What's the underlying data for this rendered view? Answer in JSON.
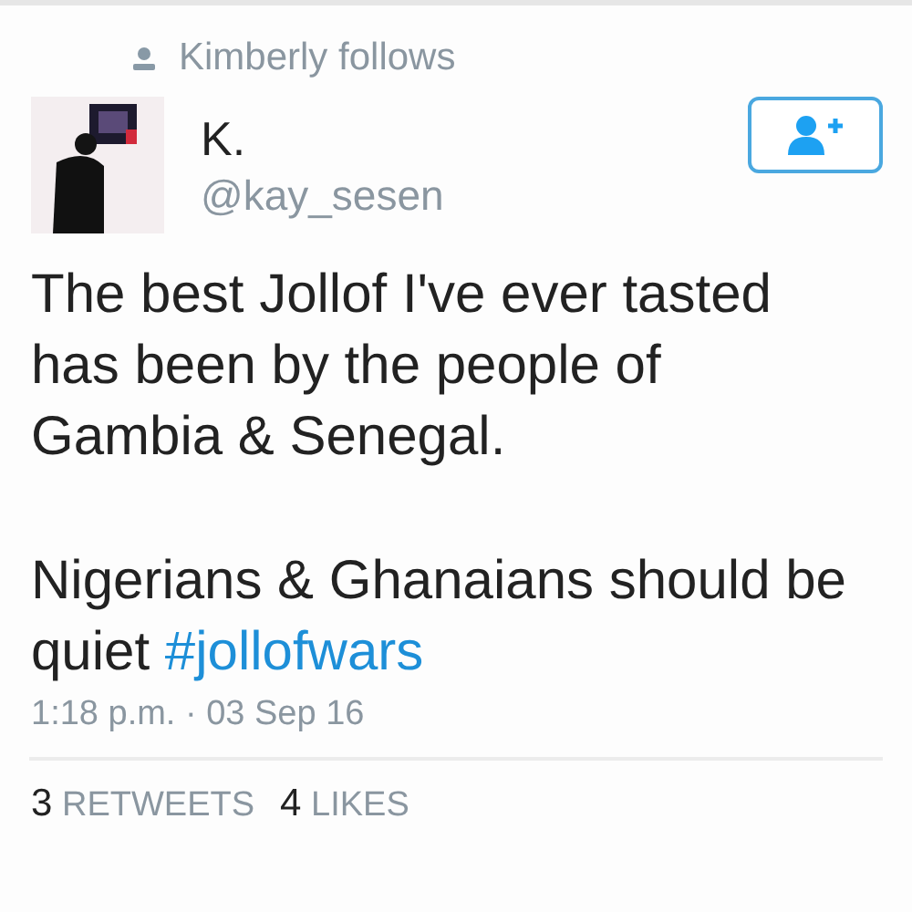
{
  "social_context": "Kimberly follows",
  "author": {
    "name": "K.",
    "handle": "@kay_sesen"
  },
  "follow_button": {
    "following": false
  },
  "tweet": {
    "paragraphs": [
      {
        "text": "The best Jollof I've ever tasted has been by the people of Gambia & Senegal."
      },
      {
        "text": "Nigerians & Ghanaians should be quiet",
        "hashtag": "#jollofwars"
      }
    ],
    "timestamp": "1:18 p.m. · 03 Sep 16"
  },
  "stats": [
    {
      "count": "3",
      "label": "RETWEETS"
    },
    {
      "count": "4",
      "label": "LIKES"
    }
  ]
}
